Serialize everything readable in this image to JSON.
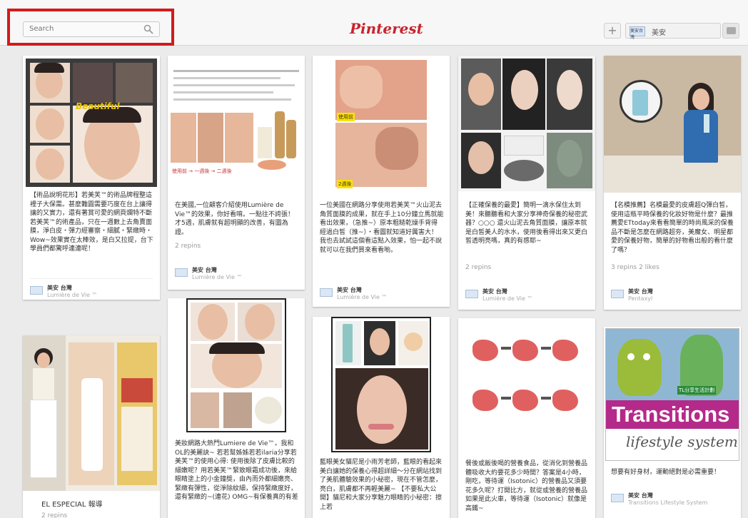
{
  "header": {
    "search_placeholder": "Search",
    "logo": "Pinterest",
    "add_button": "+",
    "user_name": "美安",
    "user_avatar_text": "美安台灣"
  },
  "pins": [
    {
      "desc": "【術品說明花形】若美芙™的術品牌程整這裡子大保需。甚麼難圓需要巧度在台上讓得讓的又實力，還有著賞可愛的網頁爛特不斷若美芙™的術產品，只在一週數上去角賣面膜，淨白皮・彈力經審察・細膩・緊緻時・Wow~效果實在太棒效，是白又拉提，台下學員們都驚呼連連呢！",
      "repins": "",
      "user": "美安 台灣",
      "board": "Lumière de Vie ™"
    },
    {
      "desc": "在美國,一位顧客介紹使用Lumière de Vie™的效果，你好看唷。一點往不誇張！才5週，肌膚就有超明顯的改善，有圖為證。",
      "repins": "2 repins",
      "user": "美安 台灣",
      "board": "Lumière de Vie ™"
    },
    {
      "desc": "一位美國在網路分享使用若美芙™火山泥去角質面膜的成果，就在手上10分鐘立馬就能看出效果，（急推~）原本粗糙乾燥手背得經過白皙（推~）・看圖就知道好厲害大！我也去試試這個看這點入效果，怕一起不說就可以在我們買來看看喲。",
      "repins": "",
      "user": "美安 台灣",
      "board": "Lumière de Vie ™"
    },
    {
      "desc": "【正確保養的最愛】簡明一滴水保住太到美！來聽聽看和大家分享神奇保養的秘密武器？○○○ 還火山泥去角質面膜，讓原本就是白皙美人的水水，使用後看得出來又更白皙透明亮嗎，真的有感耶~",
      "repins": "2 repins",
      "user": "美安 台灣",
      "board": "Lumière de Vie ™"
    },
    {
      "desc": "【名模推薦】名模最愛的皮膚超Q彈白皙，使用這瓶平時保養的化妝好物是什麼？最推薦愛ETtoday來看看簡單的時尚風采的保養品不斷是怎麼在網路超夯，美魔女、明星都愛的保養好物，簡單的好物看出般的看什麼了嗎？",
      "repins": "3 repins  2 likes",
      "user": "美安 台灣",
      "board": "Pentaxyl"
    },
    {
      "desc": "EL ESPECIAL 報導",
      "repins": "2 repins",
      "user": "",
      "board": ""
    },
    {
      "desc": "美妝網路大熱門Lumiere de Vie™，我和OL的美麗訣~ 若若幫姊姊若若ilaria分享若美芙™的使用心得: 使用後除了皮膚比較的細嫩呢？用若美芙™緊致眼霜成功後，來給眼睛塗上的小金鐘獎，由內而外都細嫩亮、緊緻有彈性，從淨除紋細，保持緊緻度好，還有緊緻的~(連花) OMG~有保養真的有差",
      "repins": "",
      "user": "",
      "board": ""
    },
    {
      "desc": "藍眼美女貓尼是小雨芳老師，藍眼的看起來美白讓她的保養心得超詳細～分在網站找到了美肌體驗效果的小秘密，現在不管怎麼，亮白，肌膚都不再輕美麗~ 【不要私大公開】貓尼和大家分享魅力眼睛的小秘密：擦上若",
      "repins": "",
      "user": "",
      "board": ""
    },
    {
      "desc": "餐後或飯後喝的營養食品，從消化到營養品體吸收大約要花多少時間？答案是4小時，剛吃，等待運（Isotonic）的營養品又須要花多久呢？打開比方，就從或營養的營養品如果是此火車，等待運（Isotonic）就像是高鐵~",
      "repins": "",
      "user": "",
      "board": ""
    },
    {
      "desc": "想要有好身材，運動絕對是必需重要！",
      "repins": "",
      "user": "美安 台灣",
      "board": "Transitions Lifestyle System"
    }
  ],
  "image_text": {
    "pin1_badge": "Beautiful",
    "pin2_arrow": "使用前 → 一週後 → 二週後",
    "pin3_before": "使用前",
    "pin3_after": "2週後",
    "pin10_title": "Transitions",
    "pin10_sub": "lifestyle system",
    "pin10_badge": "TL分享生活計劃"
  },
  "colors": {
    "brand_red": "#c8232c",
    "highlight": "#d21b1b"
  }
}
